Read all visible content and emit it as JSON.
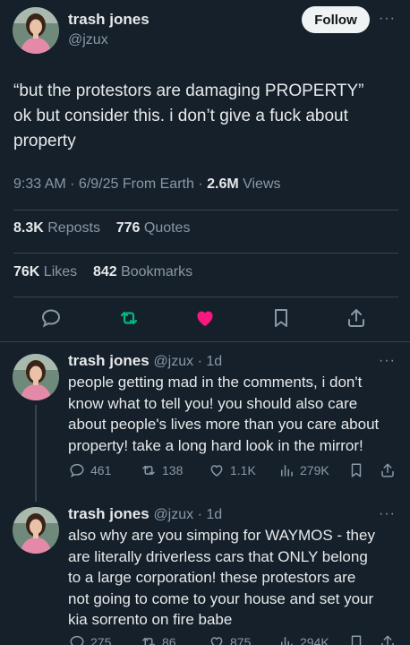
{
  "main_tweet": {
    "author_name": "trash jones",
    "author_handle": "@jzux",
    "follow_label": "Follow",
    "more_label": "···",
    "text": "“but the protestors are damaging PROPERTY”\nok but consider this. i don’t give a fuck about\nproperty",
    "timestamp": "9:33 AM · 6/9/25 From Earth · ",
    "views_count": "2.6M",
    "views_label": " Views",
    "reposts_count": "8.3K",
    "reposts_label": " Reposts",
    "quotes_count": "776",
    "quotes_label": " Quotes",
    "likes_count": "76K",
    "likes_label": " Likes",
    "bookmarks_count": "842",
    "bookmarks_label": " Bookmarks"
  },
  "replies": [
    {
      "author_name": "trash jones",
      "author_handle": "@jzux",
      "time": " · 1d",
      "more_label": "···",
      "text": "people getting mad in the comments, i don't\nknow what to tell you! you should also care\nabout people's lives more than you care about\nproperty! take a long hard look in the mirror!",
      "replies": "461",
      "reposts": "138",
      "likes": "1.1K",
      "views": "279K"
    },
    {
      "author_name": "trash jones",
      "author_handle": "@jzux",
      "time": " · 1d",
      "more_label": "···",
      "text": "also why are you simping for WAYMOS - they\nare literally driverless cars that ONLY belong\nto a large corporation! these protestors are\nnot going to come to your house and set your\nkia sorrento on fire babe",
      "replies": "275",
      "reposts": "86",
      "likes": "875",
      "views": "294K"
    }
  ],
  "colors": {
    "background": "#15202b",
    "text": "#e7e9ea",
    "muted": "#8b98a5",
    "like_active": "#f91880",
    "repost_active": "#00ba7c",
    "divider": "#38444d"
  },
  "icons": [
    "reply-icon",
    "repost-icon",
    "like-icon",
    "bookmark-icon",
    "share-icon",
    "views-icon"
  ]
}
